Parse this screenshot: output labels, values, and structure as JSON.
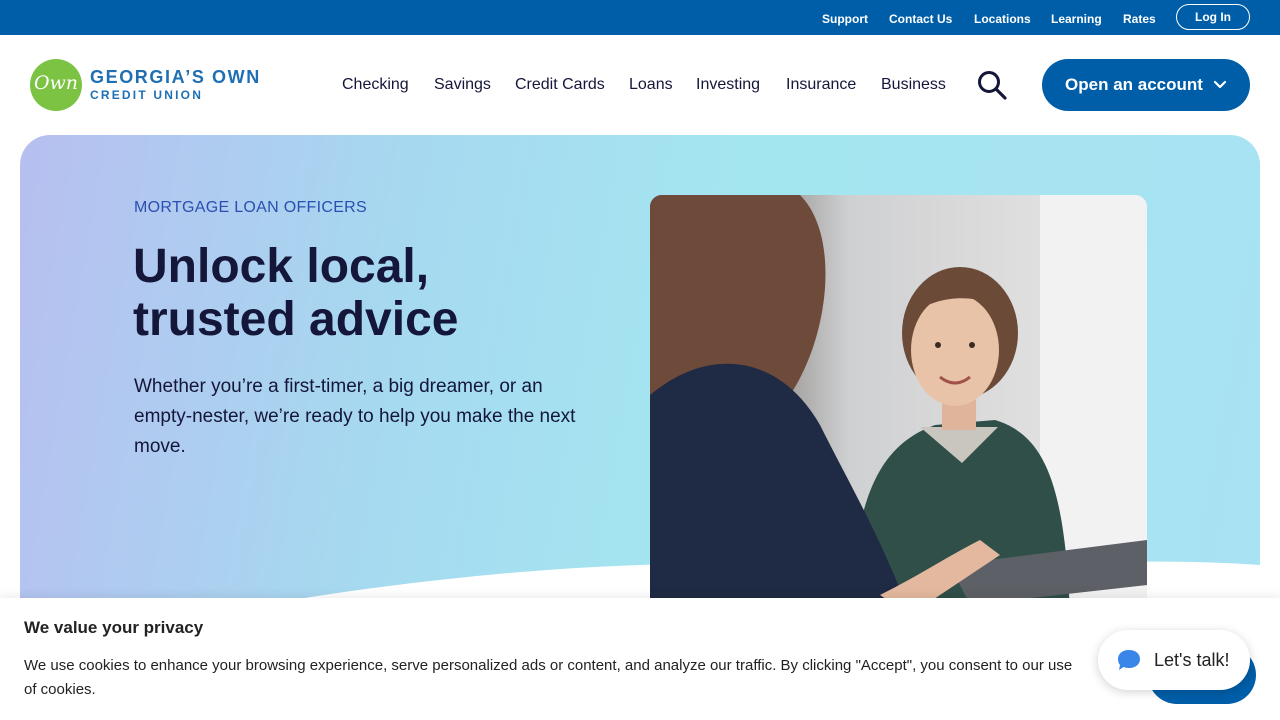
{
  "utility_nav": {
    "links": [
      "Support",
      "Contact Us",
      "Locations",
      "Learning",
      "Rates"
    ],
    "login_label": "Log In"
  },
  "brand": {
    "logo_mark": "Own",
    "name_line1": "GEORGIA’S OWN",
    "name_line2": "CREDIT UNION",
    "primary_color": "#005ea8",
    "logo_green": "#7cc243"
  },
  "main_nav": {
    "items": [
      "Checking",
      "Savings",
      "Credit Cards",
      "Loans",
      "Investing",
      "Insurance",
      "Business"
    ],
    "search_icon": "search-icon",
    "open_account_label": "Open an account",
    "open_account_icon": "chevron-down-icon"
  },
  "hero": {
    "eyebrow": "MORTGAGE LOAN OFFICERS",
    "headline": "Unlock local, trusted advice",
    "subhead": "Whether you’re a first-timer, a big dreamer, or an empty-nester, we’re ready to help you make the next move."
  },
  "cookie_banner": {
    "title": "We value your privacy",
    "text": "We use cookies to enhance your browsing experience, serve personalized ads or content, and analyze our traffic. By clicking \"Accept\", you consent to our use of cookies."
  },
  "chat": {
    "label": "Let's talk!",
    "icon": "chat-bubble-icon"
  }
}
